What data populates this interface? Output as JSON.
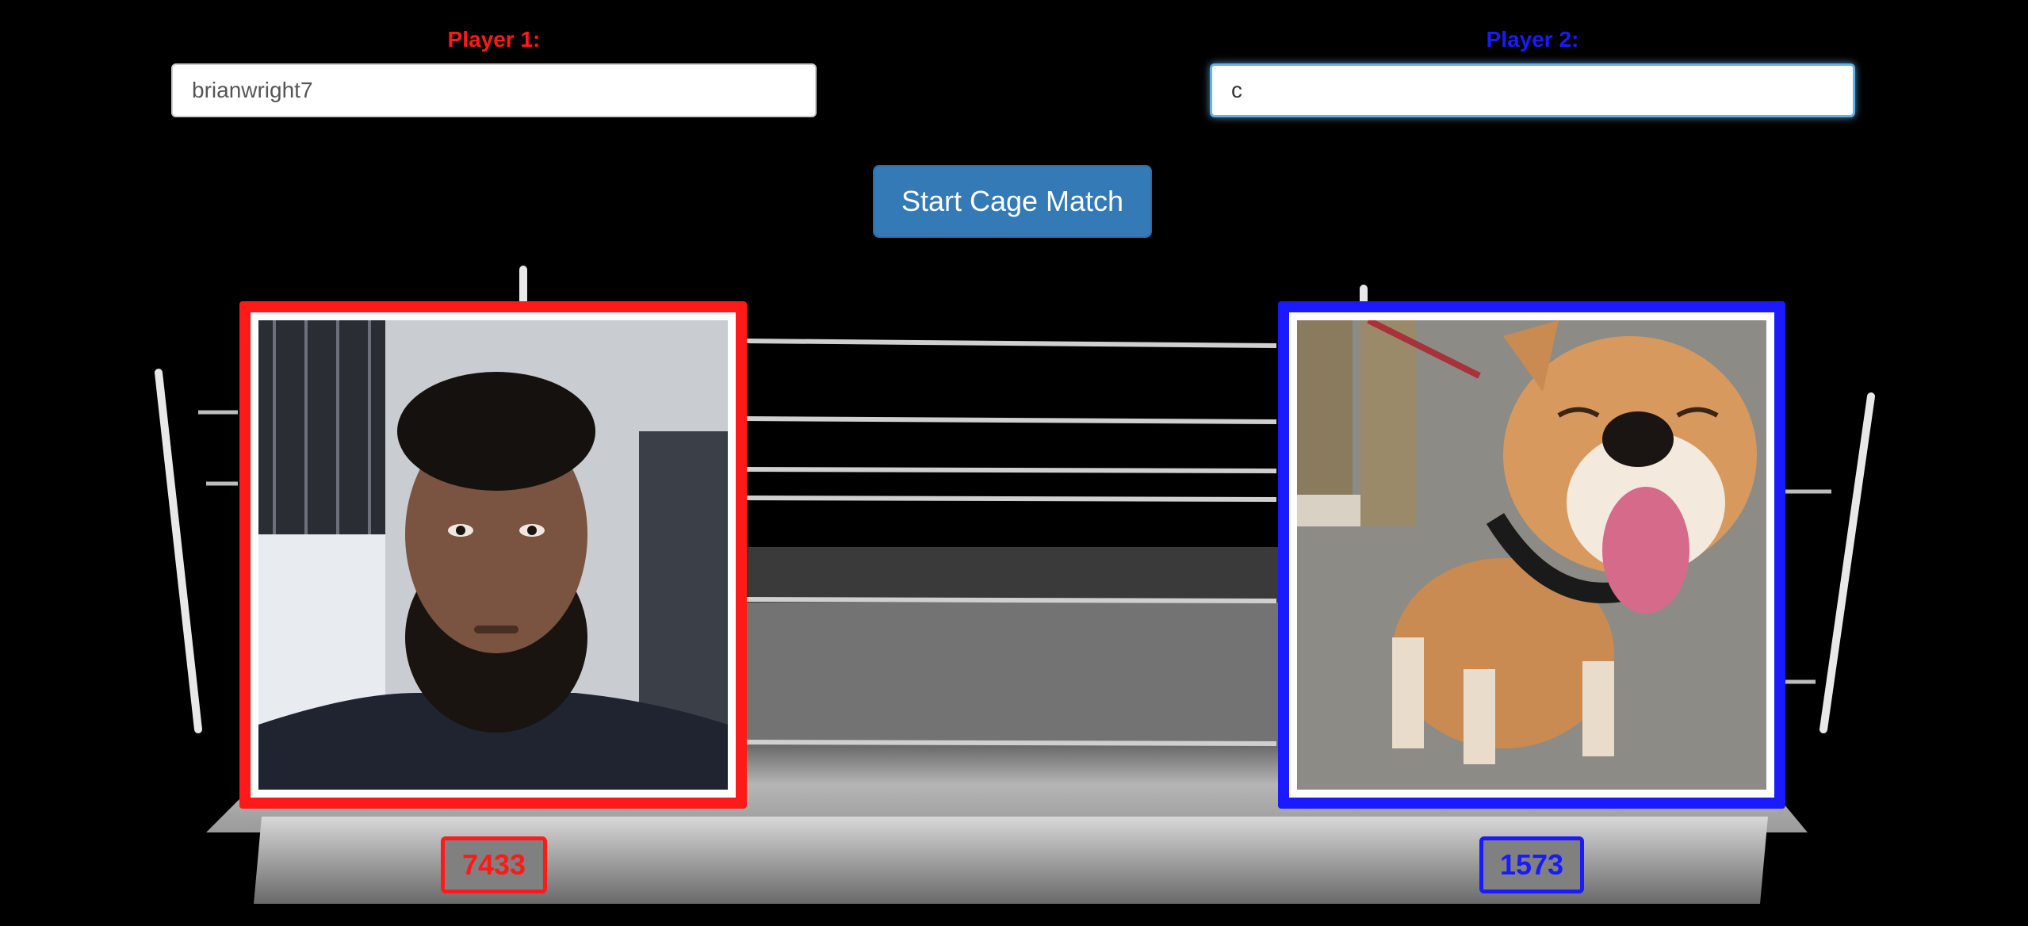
{
  "colors": {
    "player1": "#ff1a1a",
    "player2": "#1a1aff",
    "button_bg": "#337ab7",
    "background": "#000000"
  },
  "player1": {
    "label": "Player 1:",
    "input_value": "brianwright7",
    "photo": "man-selfie-photo",
    "score": "7433"
  },
  "player2": {
    "label": "Player 2:",
    "input_value": "c",
    "photo": "shiba-inu-dog-photo",
    "score": "1573"
  },
  "start_button": {
    "label": "Start Cage Match"
  }
}
